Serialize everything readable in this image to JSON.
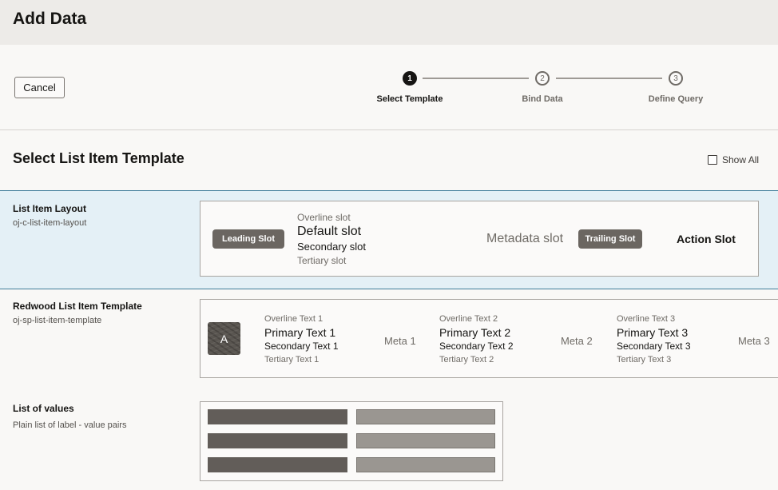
{
  "header": {
    "title": "Add Data"
  },
  "toolbar": {
    "cancel_label": "Cancel"
  },
  "train": {
    "steps": [
      {
        "number": "1",
        "label": "Select Template",
        "state": "active"
      },
      {
        "number": "2",
        "label": "Bind Data",
        "state": "inactive"
      },
      {
        "number": "3",
        "label": "Define Query",
        "state": "inactive"
      }
    ]
  },
  "main": {
    "title": "Select List Item Template",
    "show_all_label": "Show All",
    "show_all_checked": false
  },
  "templates": [
    {
      "title": "List Item Layout",
      "subtitle": "oj-c-list-item-layout",
      "selected": true,
      "preview": {
        "leading": "Leading Slot",
        "overline": "Overline slot",
        "default": "Default slot",
        "secondary": "Secondary slot",
        "tertiary": "Tertiary slot",
        "metadata": "Metadata slot",
        "trailing": "Trailing Slot",
        "action": "Action Slot"
      }
    },
    {
      "title": "Redwood List Item Template",
      "subtitle": "oj-sp-list-item-template",
      "selected": false,
      "preview": {
        "avatar_initial": "A",
        "items": [
          {
            "overline": "Overline Text 1",
            "primary": "Primary Text 1",
            "secondary": "Secondary Text 1",
            "tertiary": "Tertiary Text 1",
            "meta": "Meta 1"
          },
          {
            "overline": "Overline Text 2",
            "primary": "Primary Text 2",
            "secondary": "Secondary Text 2",
            "tertiary": "Tertiary Text 2",
            "meta": "Meta 2"
          },
          {
            "overline": "Overline Text 3",
            "primary": "Primary Text 3",
            "secondary": "Secondary Text 3",
            "tertiary": "Tertiary Text 3",
            "meta": "Meta 3"
          }
        ]
      }
    },
    {
      "title": "List of values",
      "subtitle": "Plain list of label - value pairs",
      "selected": false
    }
  ],
  "colors": {
    "selected_row_bg": "#e4f0f6",
    "selected_row_border": "#3f7d9a",
    "pill_bg": "#6b6661",
    "dark_bar": "#625d59",
    "light_bar": "#9a9691"
  }
}
